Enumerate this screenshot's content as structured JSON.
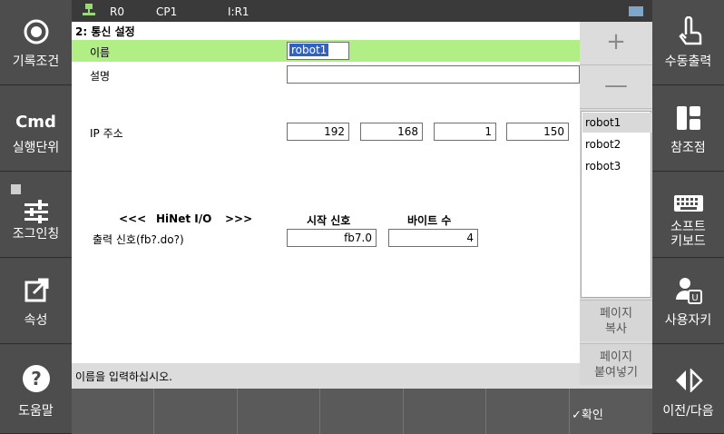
{
  "top": {
    "r": "R0",
    "cp": "CP1",
    "i": "I:R1"
  },
  "left": [
    "기록조건",
    "실행단위",
    "조그인칭",
    "속성",
    "도움말"
  ],
  "left_cmd": "Cmd",
  "right": [
    "수동출력",
    "참조점",
    "소프트\n키보드",
    "사용자키",
    "이전/다음"
  ],
  "title": "2: 통신 설정",
  "name_label": "이름",
  "name_value": "robot1",
  "desc_label": "설명",
  "ip_label": "IP 주소",
  "ip": [
    "192",
    "168",
    "1",
    "150"
  ],
  "hinet": {
    "left_arrows": "<<<",
    "label": "HiNet I/O",
    "right_arrows": ">>>",
    "start_header": "시작 신호",
    "bytes_header": "바이트 수",
    "out_label": "출력 신호(fb?.do?)",
    "start_value": "fb7.0",
    "bytes_value": "4"
  },
  "status": "이름을 입력하십시오.",
  "plus": "+",
  "minus": "—",
  "robots": [
    "robot1",
    "robot2",
    "robot3"
  ],
  "page_copy": "페이지\n복사",
  "page_paste": "페이지\n붙여넣기",
  "ok": "✓확인"
}
